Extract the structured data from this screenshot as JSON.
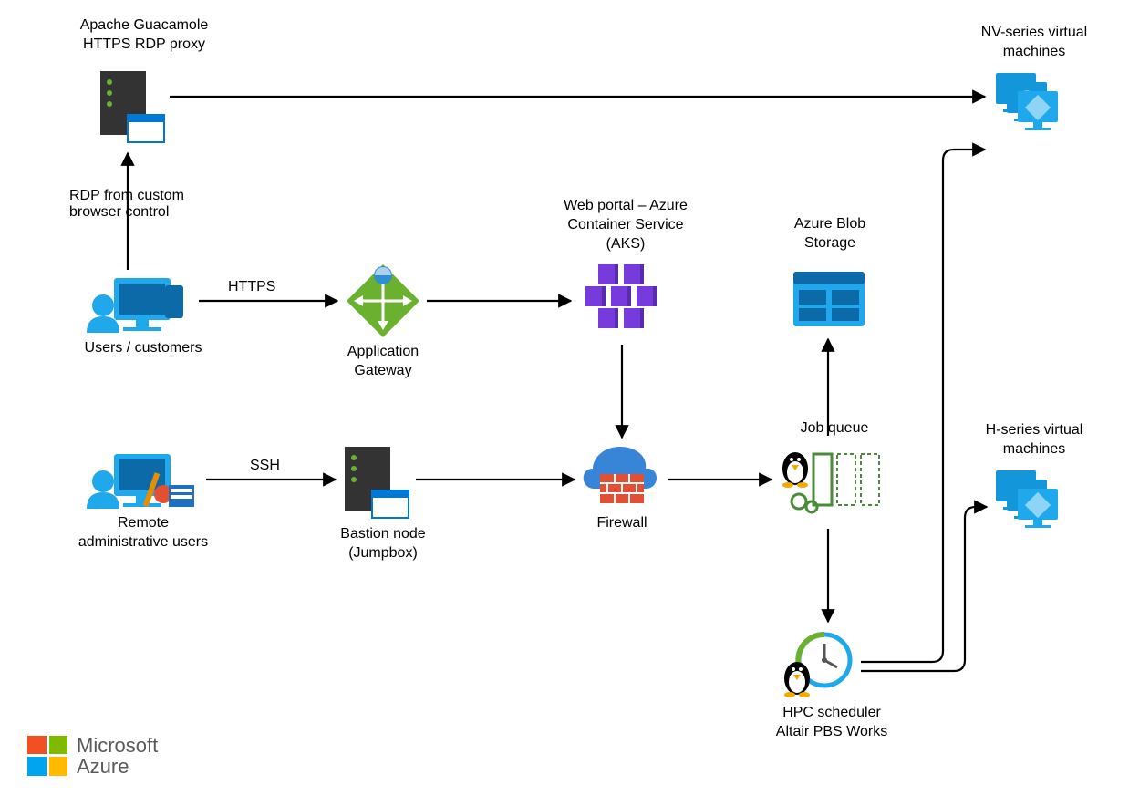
{
  "nodes": {
    "guacamole": {
      "label": "Apache Guacamole\nHTTPS RDP proxy"
    },
    "nvseries": {
      "label": "NV-series virtual\nmachines"
    },
    "hseries": {
      "label": "H-series virtual\nmachines"
    },
    "users": {
      "label": "Users / customers"
    },
    "admins": {
      "label": "Remote\nadministrative users"
    },
    "appgw": {
      "label": "Application\nGateway"
    },
    "bastion": {
      "label": "Bastion node\n(Jumpbox)"
    },
    "aks": {
      "label": "Web portal – Azure\nContainer Service\n(AKS)"
    },
    "firewall": {
      "label": "Firewall"
    },
    "blob": {
      "label": "Azure Blob\nStorage"
    },
    "jobqueue": {
      "label": "Job queue"
    },
    "hpc": {
      "label": "HPC scheduler\nAltair PBS Works"
    }
  },
  "edges": {
    "rdp": {
      "label": "RDP from custom\nbrowser control"
    },
    "https": {
      "label": "HTTPS"
    },
    "ssh": {
      "label": "SSH"
    }
  },
  "footer": {
    "brand": "Microsoft",
    "product": "Azure"
  },
  "colors": {
    "azure_blue": "#0078D4",
    "green": "#6BB130",
    "purple": "#773ADC",
    "orange": "#F25022",
    "yellow": "#FFB900",
    "ms_green": "#7FBA00",
    "ms_blue": "#00A4EF",
    "firewall_red": "#E34F32",
    "cloud": "#3884D6"
  }
}
